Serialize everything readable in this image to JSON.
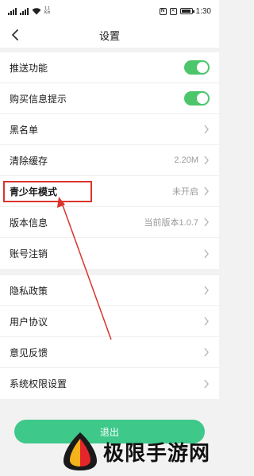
{
  "status_bar": {
    "network_speed": "1.1\nK/s",
    "time": "1:30"
  },
  "nav": {
    "title": "设置"
  },
  "group1": [
    {
      "label": "推送功能",
      "type": "toggle",
      "value": true
    },
    {
      "label": "购买信息提示",
      "type": "toggle",
      "value": true
    },
    {
      "label": "黑名单",
      "type": "link"
    },
    {
      "label": "清除缓存",
      "type": "link",
      "value": "2.20M"
    },
    {
      "label": "青少年模式",
      "type": "link",
      "value": "未开启"
    },
    {
      "label": "版本信息",
      "type": "link",
      "value": "当前版本1.0.7"
    },
    {
      "label": "账号注销",
      "type": "link"
    }
  ],
  "group2": [
    {
      "label": "隐私政策"
    },
    {
      "label": "用户协议"
    },
    {
      "label": "意见反馈"
    },
    {
      "label": "系统权限设置"
    }
  ],
  "logout_label": "退出",
  "watermark": "极限手游网",
  "colors": {
    "accent_green": "#4cc56b",
    "button_green": "#3ec88a",
    "highlight_red": "#d9342b"
  }
}
